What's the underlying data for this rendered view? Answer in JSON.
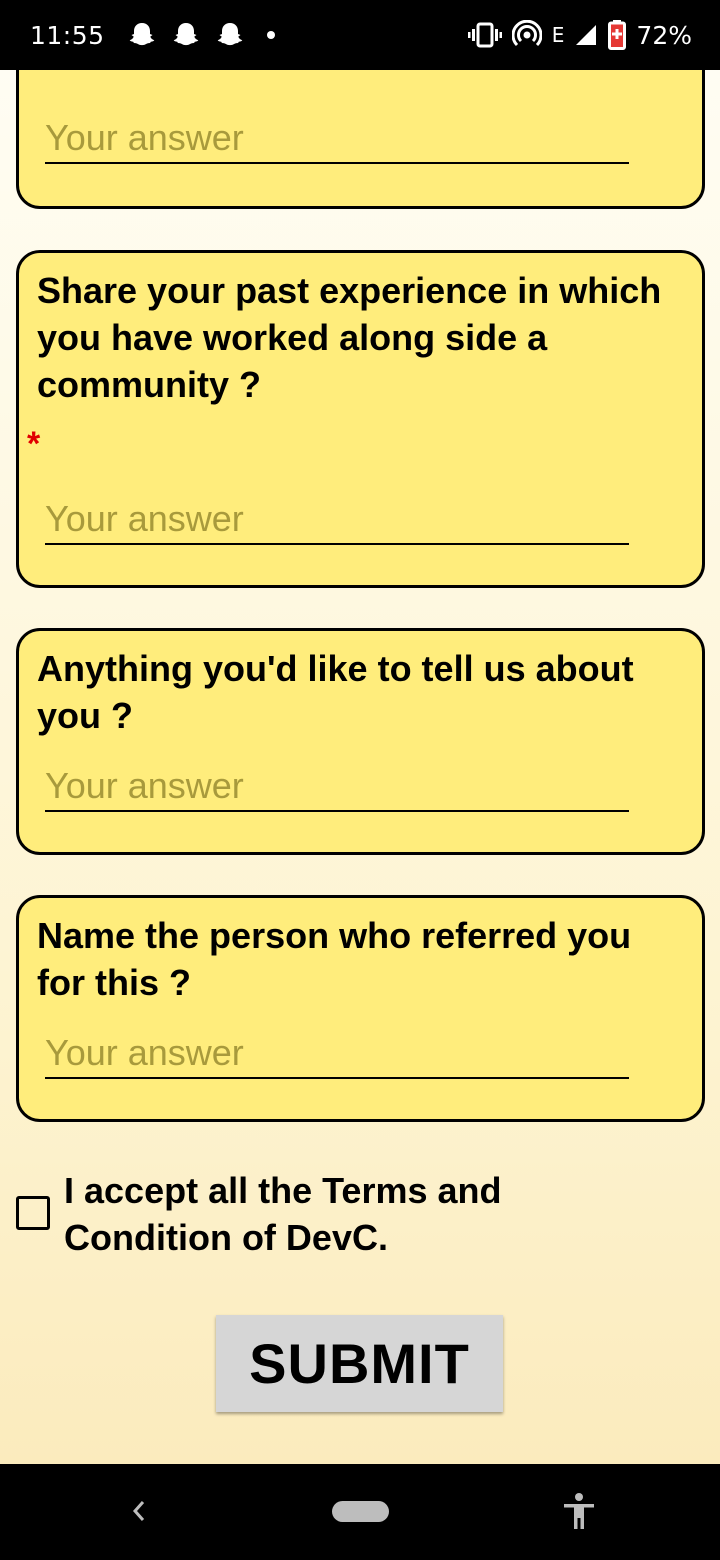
{
  "status_bar": {
    "time": "11:55",
    "network_label": "E",
    "battery_percent": "72%",
    "icons": [
      "snapchat-icon",
      "snapchat-icon",
      "snapchat-icon",
      "dot-icon",
      "vibrate-icon",
      "hotspot-icon",
      "signal-icon",
      "battery-icon"
    ]
  },
  "form": {
    "questions": [
      {
        "title": "",
        "required": false,
        "placeholder": "Your answer"
      },
      {
        "title": "Share your past experience in which you have worked along side a community ?",
        "required": true,
        "placeholder": "Your answer"
      },
      {
        "title": "Anything you'd like to tell us about you ?",
        "required": false,
        "placeholder": "Your answer"
      },
      {
        "title": "Name the person who referred you for this ?",
        "required": false,
        "placeholder": "Your answer"
      }
    ],
    "required_marker": "*",
    "terms_label": " I accept all the Terms and Condition of DevC.",
    "terms_checked": false,
    "submit_label": "SUBMIT"
  },
  "nav_bar": {
    "icons": [
      "back-icon",
      "home-pill-icon",
      "accessibility-icon"
    ]
  },
  "colors": {
    "card_background": "#ffed7c",
    "card_border": "#000000",
    "placeholder": "#a89a3c",
    "required_star": "#e00000",
    "submit_background": "#d6d6d6"
  }
}
